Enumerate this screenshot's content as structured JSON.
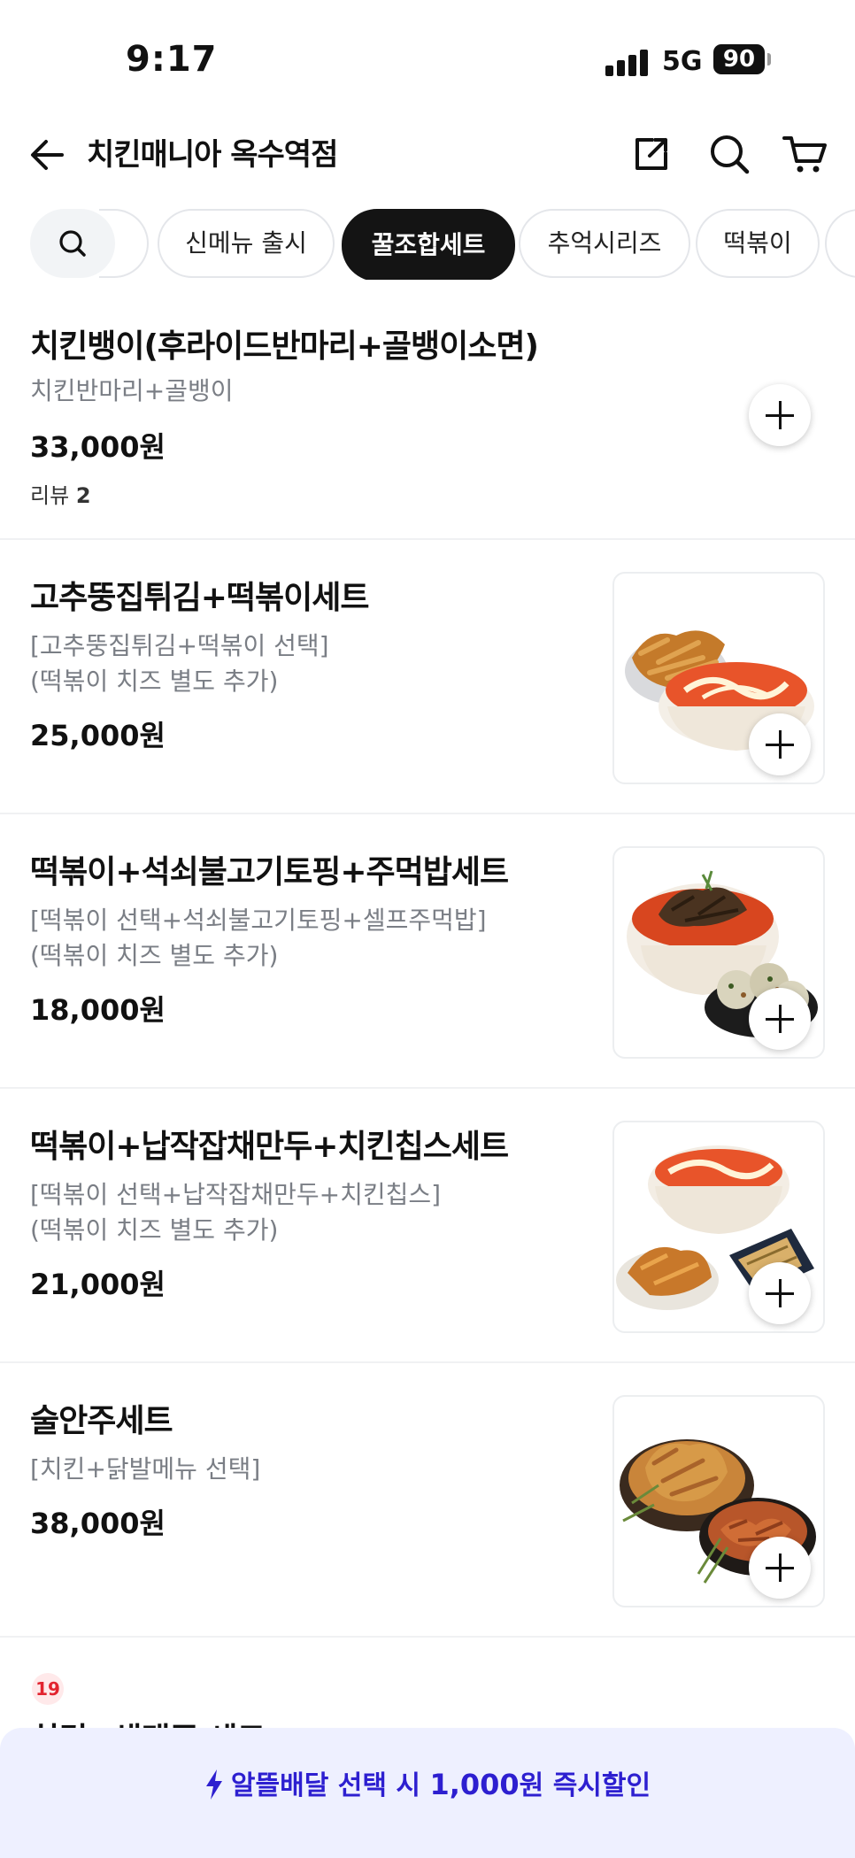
{
  "status_bar": {
    "time": "9:17",
    "network": "5G",
    "battery": "90"
  },
  "header": {
    "title": "치킨매니아 옥수역점"
  },
  "chips": [
    "신메뉴 출시",
    "꿀조합세트",
    "추억시리즈",
    "떡볶이"
  ],
  "menu_items": [
    {
      "name": "치킨뱅이(후라이드반마리+골뱅이소면)",
      "desc": [
        "치킨반마리+골뱅이"
      ],
      "price": "33,000원",
      "review_label": "리뷰",
      "review_count": "2"
    },
    {
      "name": "고추뚱집튀김+떡볶이세트",
      "desc": [
        "[고추뚱집튀김+떡볶이 선택]",
        "(떡볶이 치즈 별도 추가)"
      ],
      "price": "25,000원"
    },
    {
      "name": "떡볶이+석쇠불고기토핑+주먹밥세트",
      "desc": [
        "[떡볶이 선택+석쇠불고기토핑+셀프주먹밥]",
        "(떡볶이 치즈 별도 추가)"
      ],
      "price": "18,000원"
    },
    {
      "name": "떡볶이+납작잡채만두+치킨칩스세트",
      "desc": [
        "[떡볶이 선택+납작잡채만두+치킨칩스]",
        "(떡볶이 치즈 별도 추가)"
      ],
      "price": "21,000원"
    },
    {
      "name": "술안주세트",
      "desc": [
        "[치킨+닭발메뉴 선택]"
      ],
      "price": "38,000원"
    }
  ],
  "next_item": {
    "age_badge": "19",
    "name_partial": "치킨+생맥주 세트"
  },
  "promo": {
    "prefix": "알뜰배달 선택 시 ",
    "amount": "1,000",
    "suffix": "원 즉시할인"
  },
  "colors": {
    "accent": "#2d1fd0",
    "promo_bg": "#eef0ff",
    "active_chip": "#141414",
    "age_badge": "#e2242f"
  }
}
